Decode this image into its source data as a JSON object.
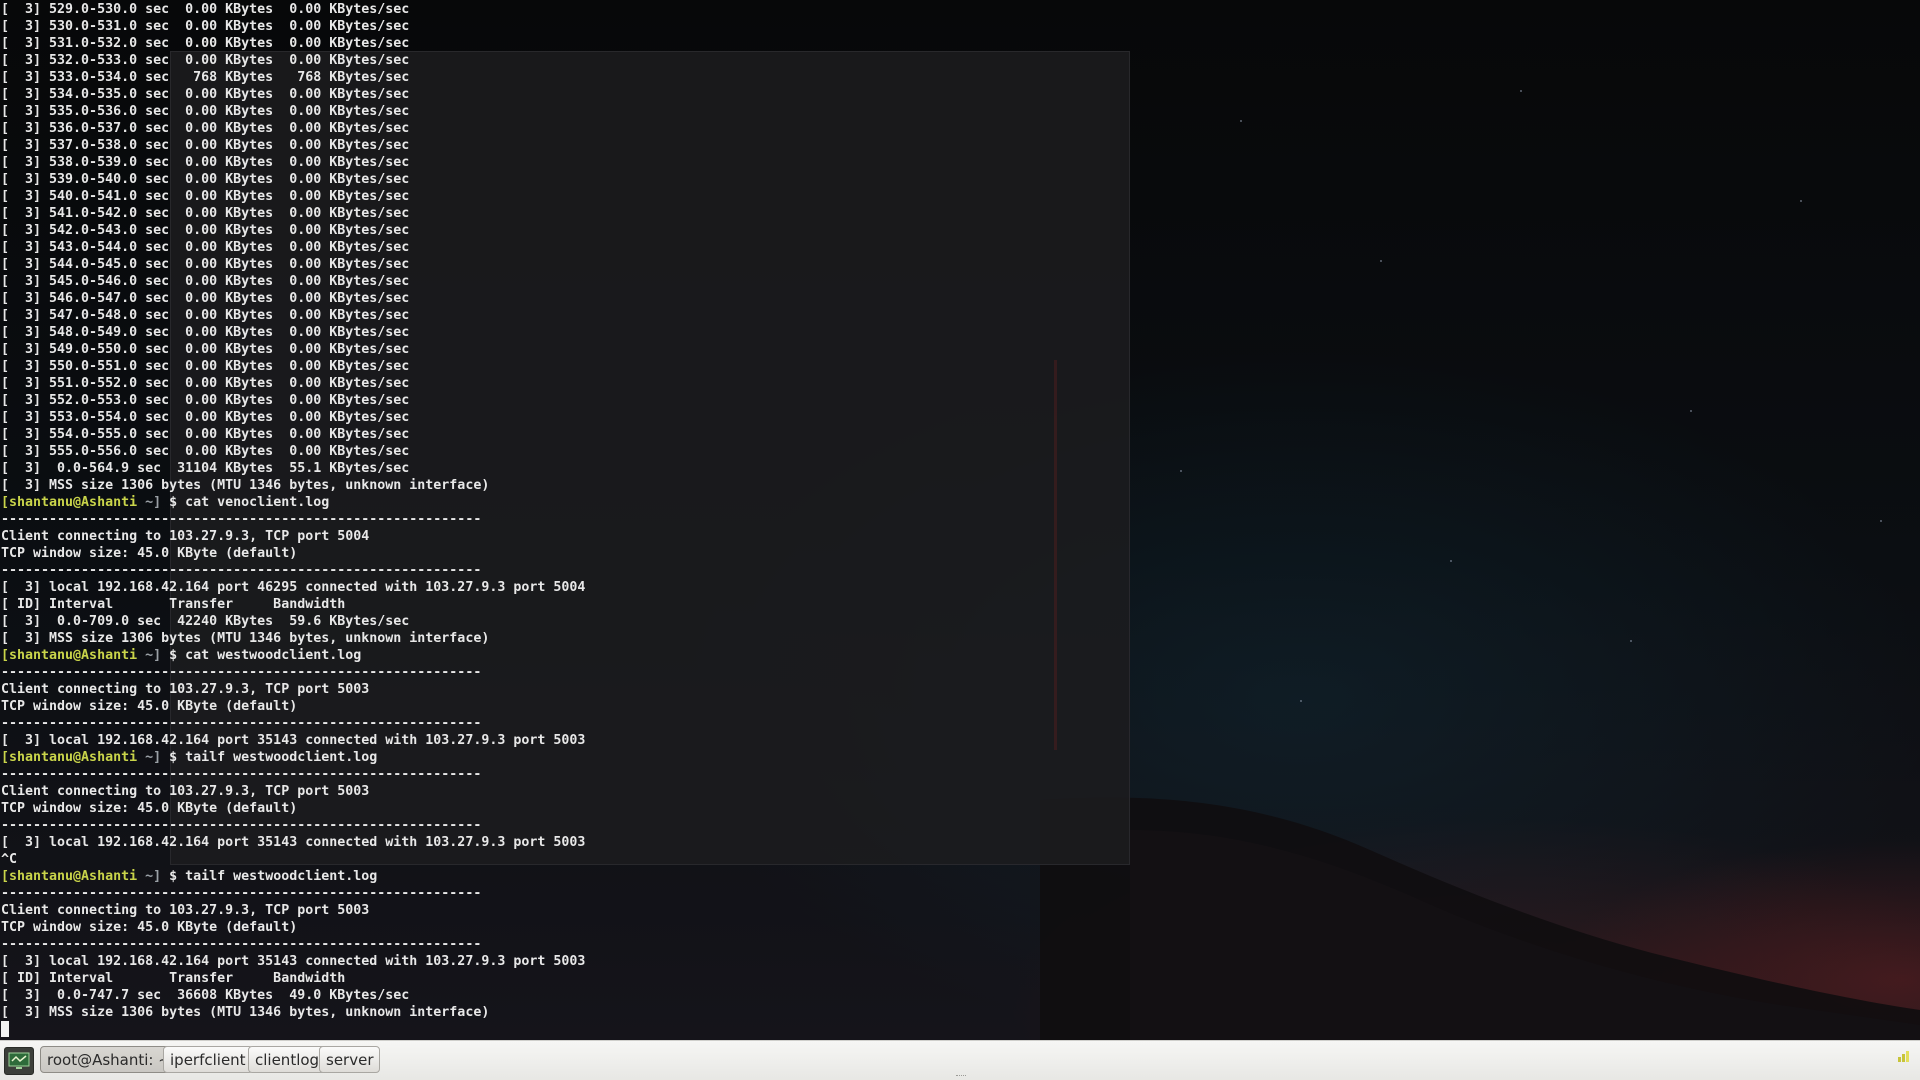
{
  "terminal": {
    "lines": [
      "[  3] 529.0-530.0 sec  0.00 KBytes  0.00 KBytes/sec",
      "[  3] 530.0-531.0 sec  0.00 KBytes  0.00 KBytes/sec",
      "[  3] 531.0-532.0 sec  0.00 KBytes  0.00 KBytes/sec",
      "[  3] 532.0-533.0 sec  0.00 KBytes  0.00 KBytes/sec",
      "[  3] 533.0-534.0 sec   768 KBytes   768 KBytes/sec",
      "[  3] 534.0-535.0 sec  0.00 KBytes  0.00 KBytes/sec",
      "[  3] 535.0-536.0 sec  0.00 KBytes  0.00 KBytes/sec",
      "[  3] 536.0-537.0 sec  0.00 KBytes  0.00 KBytes/sec",
      "[  3] 537.0-538.0 sec  0.00 KBytes  0.00 KBytes/sec",
      "[  3] 538.0-539.0 sec  0.00 KBytes  0.00 KBytes/sec",
      "[  3] 539.0-540.0 sec  0.00 KBytes  0.00 KBytes/sec",
      "[  3] 540.0-541.0 sec  0.00 KBytes  0.00 KBytes/sec",
      "[  3] 541.0-542.0 sec  0.00 KBytes  0.00 KBytes/sec",
      "[  3] 542.0-543.0 sec  0.00 KBytes  0.00 KBytes/sec",
      "[  3] 543.0-544.0 sec  0.00 KBytes  0.00 KBytes/sec",
      "[  3] 544.0-545.0 sec  0.00 KBytes  0.00 KBytes/sec",
      "[  3] 545.0-546.0 sec  0.00 KBytes  0.00 KBytes/sec",
      "[  3] 546.0-547.0 sec  0.00 KBytes  0.00 KBytes/sec",
      "[  3] 547.0-548.0 sec  0.00 KBytes  0.00 KBytes/sec",
      "[  3] 548.0-549.0 sec  0.00 KBytes  0.00 KBytes/sec",
      "[  3] 549.0-550.0 sec  0.00 KBytes  0.00 KBytes/sec",
      "[  3] 550.0-551.0 sec  0.00 KBytes  0.00 KBytes/sec",
      "[  3] 551.0-552.0 sec  0.00 KBytes  0.00 KBytes/sec",
      "[  3] 552.0-553.0 sec  0.00 KBytes  0.00 KBytes/sec",
      "[  3] 553.0-554.0 sec  0.00 KBytes  0.00 KBytes/sec",
      "[  3] 554.0-555.0 sec  0.00 KBytes  0.00 KBytes/sec",
      "[  3] 555.0-556.0 sec  0.00 KBytes  0.00 KBytes/sec",
      "[  3]  0.0-564.9 sec  31104 KBytes  55.1 KBytes/sec",
      "[  3] MSS size 1306 bytes (MTU 1346 bytes, unknown interface)",
      {
        "user": "[shantanu@Ashanti",
        "path": " ~] ",
        "cmd": "$ cat venoclient.log"
      },
      "------------------------------------------------------------",
      "Client connecting to 103.27.9.3, TCP port 5004",
      "TCP window size: 45.0 KByte (default)",
      "------------------------------------------------------------",
      "[  3] local 192.168.42.164 port 46295 connected with 103.27.9.3 port 5004",
      "[ ID] Interval       Transfer     Bandwidth",
      "[  3]  0.0-709.0 sec  42240 KBytes  59.6 KBytes/sec",
      "[  3] MSS size 1306 bytes (MTU 1346 bytes, unknown interface)",
      {
        "user": "[shantanu@Ashanti",
        "path": " ~] ",
        "cmd": "$ cat westwoodclient.log"
      },
      "------------------------------------------------------------",
      "Client connecting to 103.27.9.3, TCP port 5003",
      "TCP window size: 45.0 KByte (default)",
      "------------------------------------------------------------",
      "[  3] local 192.168.42.164 port 35143 connected with 103.27.9.3 port 5003",
      {
        "user": "[shantanu@Ashanti",
        "path": " ~] ",
        "cmd": "$ tailf westwoodclient.log"
      },
      "------------------------------------------------------------",
      "Client connecting to 103.27.9.3, TCP port 5003",
      "TCP window size: 45.0 KByte (default)",
      "------------------------------------------------------------",
      "[  3] local 192.168.42.164 port 35143 connected with 103.27.9.3 port 5003",
      "^C",
      {
        "user": "[shantanu@Ashanti",
        "path": " ~] ",
        "cmd": "$ tailf westwoodclient.log"
      },
      "------------------------------------------------------------",
      "Client connecting to 103.27.9.3, TCP port 5003",
      "TCP window size: 45.0 KByte (default)",
      "------------------------------------------------------------",
      "[  3] local 192.168.42.164 port 35143 connected with 103.27.9.3 port 5003",
      "[ ID] Interval       Transfer     Bandwidth",
      "[  3]  0.0-747.7 sec  36608 KBytes  49.0 KBytes/sec",
      "[  3] MSS size 1306 bytes (MTU 1346 bytes, unknown interface)"
    ]
  },
  "taskbar": {
    "start_icon": "monitor-icon",
    "buttons": [
      "root@Ashanti: ~",
      "iperfclient",
      "clientlog",
      "server"
    ],
    "active_index": 0,
    "tray_icon": "network-icon"
  },
  "colors": {
    "prompt_user": "#c9d44a",
    "terminal_text": "#e8e8e8"
  }
}
